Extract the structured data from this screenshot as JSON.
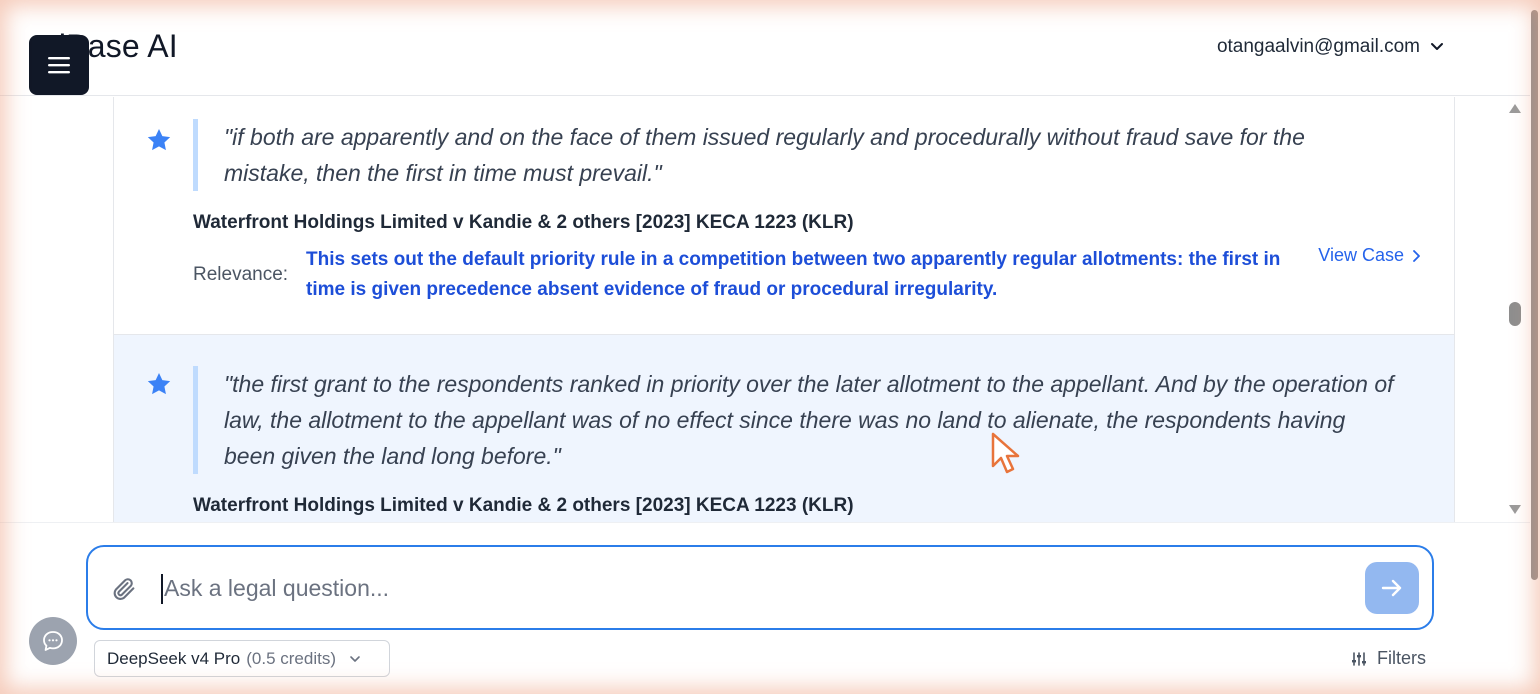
{
  "header": {
    "brand": "riBase AI",
    "user_email": "otangaalvin@gmail.com",
    "menu_icon": "hamburger-icon",
    "user_chevron_icon": "chevron-down-icon"
  },
  "results": [
    {
      "starred": true,
      "quote": "\"if both are apparently and on the face of them issued regularly and procedurally without fraud save for the mistake, then the first in time must prevail.\"",
      "case_title": "Waterfront Holdings Limited v Kandie & 2 others [2023] KECA 1223 (KLR)",
      "relevance_label": "Relevance:",
      "relevance_text": "This sets out the default priority rule in a competition between two apparently regular allotments: the first in time is given precedence absent evidence of fraud or procedural irregularity.",
      "view_case_label": "View Case"
    },
    {
      "starred": true,
      "quote": "\"the first grant to the respondents ranked in priority over the later allotment to the appellant. And by the operation of law, the allotment to the appellant was of no effect since there was no land to alienate, the respondents having been given the land long before.\"",
      "case_title": "Waterfront Holdings Limited v Kandie & 2 others [2023] KECA 1223 (KLR)"
    }
  ],
  "composer": {
    "placeholder": "Ask a legal question...",
    "value": "",
    "attach_icon": "paperclip-icon",
    "send_icon": "arrow-right-icon"
  },
  "footer": {
    "model_name": "DeepSeek v4 Pro",
    "model_credits": "(0.5 credits)",
    "filters_label": "Filters",
    "filters_icon": "sliders-icon",
    "chat_icon": "chat-bubble-icon"
  },
  "colors": {
    "accent": "#2b7de9",
    "relevance": "#1d4ed8",
    "star": "#3b82f6",
    "menu_bg": "#111827",
    "highlight_card": "#eff5fe"
  }
}
